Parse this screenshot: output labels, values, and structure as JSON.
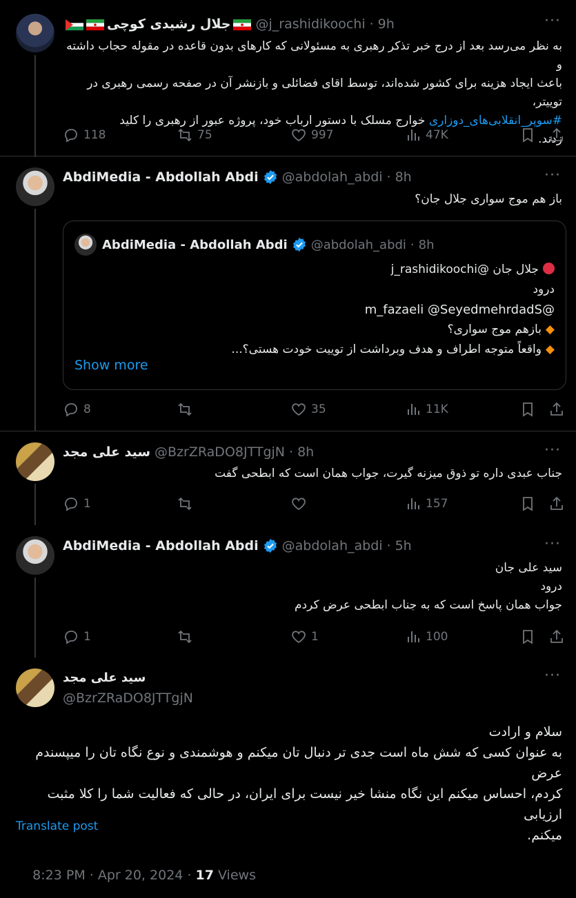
{
  "post1": {
    "name": "جلال رشیدی کوچی",
    "handle": "@j_rashidikoochi",
    "dot": "·",
    "time": "9h",
    "lines": [
      "به نظر می‌رسد بعد از درج خبر تذکر رهبری به مسئولانی که کارهای بدون قاعده در مقوله حجاب داشته و",
      "باعث ایجاد هزینه برای کشور شده‌اند، توسط اقای فضائلی و بازنشر آن در صفحه رسمی رهبری در توییتر،"
    ],
    "hashtag": "#سوپر_انقلابی‌های_دوزاری",
    "line3_rest": " خوارج مسلک با دستور ارباب خود، پروژه عبور از رهبری را کلید",
    "line4": "زدند.",
    "replies": "118",
    "reposts": "75",
    "likes": "997",
    "views": "47K"
  },
  "post2": {
    "name": "AbdiMedia - Abdollah Abdi",
    "handle": "@abdolah_abdi",
    "dot": "·",
    "time": "8h",
    "text": "باز هم موج سواری جلال جان؟",
    "quote": {
      "name": "AbdiMedia - Abdollah Abdi",
      "handle": "@abdolah_abdi",
      "dot": "·",
      "time": "8h",
      "line1_mention": "@j_rashidikoochi",
      "line1_text": "جلال جان",
      "line2": "درود",
      "line3": "@m_fazaeli @SeyedmehrdadS",
      "line4": "بازهم موج سواری؟",
      "line5": "واقعاً متوجه اطراف و هدف وبرداشت از توییت خودت هستی؟...",
      "show_more": "Show more"
    },
    "replies": "8",
    "reposts": "",
    "likes": "35",
    "views": "11K"
  },
  "post3": {
    "name": "سید علی مجد",
    "handle": "@BzrZRaDO8JTTgjN",
    "dot": "·",
    "time": "8h",
    "text": "جناب عبدی داره تو ذوق میزنه گیرت، جواب همان است که ابطحی گفت",
    "replies": "1",
    "reposts": "",
    "likes": "",
    "views": "157"
  },
  "post4": {
    "name": "AbdiMedia - Abdollah Abdi",
    "handle": "@abdolah_abdi",
    "dot": "·",
    "time": "5h",
    "line1": "سید علی جان",
    "line2": "درود",
    "line3": "جواب همان پاسخ است که  به جناب ابطحی عرض کردم",
    "replies": "1",
    "reposts": "",
    "likes": "1",
    "views": "100"
  },
  "main": {
    "name": "سید علی مجد",
    "handle": "@BzrZRaDO8JTTgjN",
    "line1": "سلام و ارادت",
    "line2": "به عنوان کسی که شش ماه است جدی تر دنبال تان میکنم و  هوشمندی و نوع نگاه تان را میپسندم عرض",
    "line3": "کردم، احساس میکنم این نگاه منشا خیر نیست برای ایران، در حالی که فعالیت شما را کلا مثبت ارزیابی",
    "line4": "میکنم.",
    "translate": "Translate post",
    "timestamp": "8:23 PM · Apr 20, 2024 · ",
    "views_count": "17",
    "views_label": " Views"
  },
  "colors": {
    "accent": "#1d9bf0",
    "muted": "#71767b",
    "border": "#2f3336"
  }
}
